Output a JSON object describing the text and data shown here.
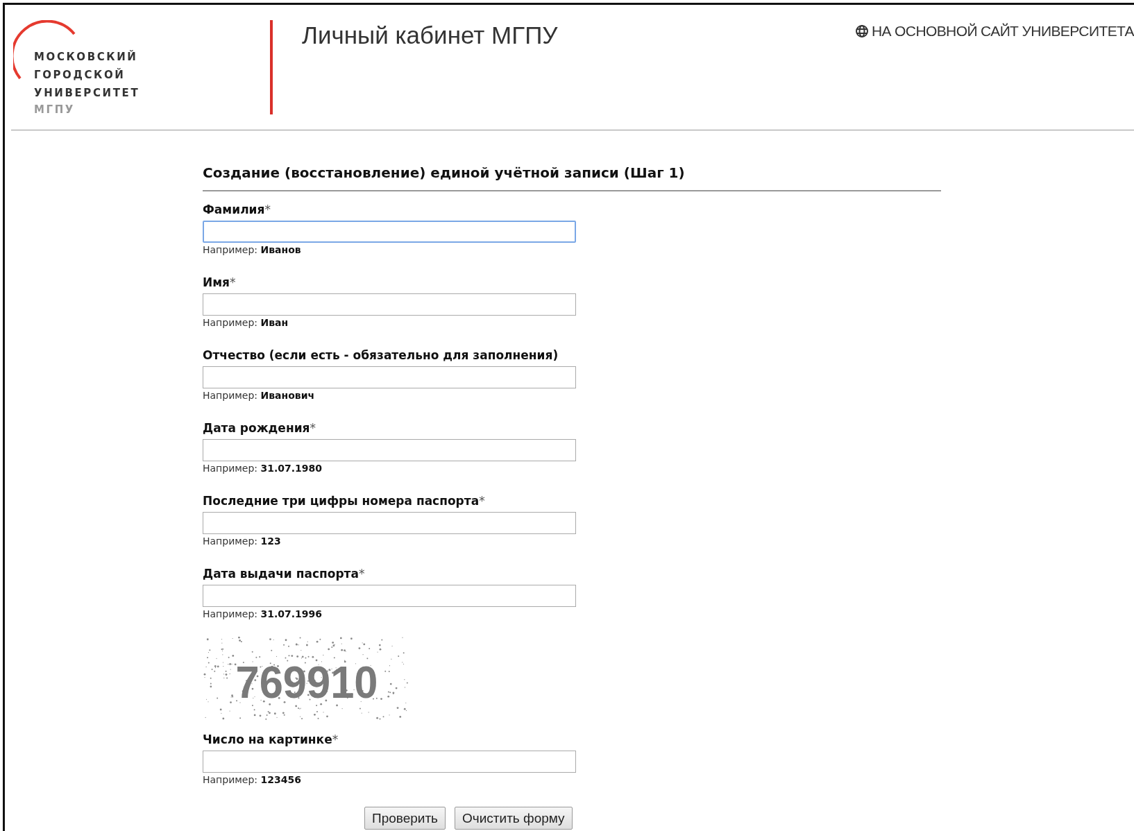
{
  "header": {
    "logo_lines": [
      "МОСКОВСКИЙ",
      "ГОРОДСКОЙ",
      "УНИВЕРСИТЕТ"
    ],
    "logo_abbr": "МГПУ",
    "title": "Личный кабинет МГПУ",
    "main_site_link": "НА ОСНОВНОЙ САЙТ УНИВЕРСИТЕТА"
  },
  "form": {
    "heading": "Создание (восстановление) единой учётной записи (Шаг 1)",
    "fields": [
      {
        "label": "Фамилия",
        "required_mark": "*",
        "focused": true,
        "hint": "Например: **Иванов**"
      },
      {
        "label": "Имя",
        "required_mark": "*",
        "focused": false,
        "hint": "Например: **Иван**"
      },
      {
        "label": "Отчество (если есть - обязательно для заполнения)",
        "focused": false,
        "hint": "Например: **Иванович**"
      },
      {
        "label": "Дата рождения",
        "required_mark": "*",
        "focused": false,
        "hint": "Например: **31.07.1980**"
      },
      {
        "label": "Последние три цифры номера паспорта",
        "required_mark": "*",
        "focused": false,
        "hint": "Например: **123**"
      },
      {
        "label": "Дата выдачи паспорта",
        "required_mark": "*",
        "focused": false,
        "hint": "Например: **31.07.1996**"
      }
    ],
    "captcha": {
      "code": "769910"
    },
    "captcha_field": {
      "label": "Число на картинке",
      "required_mark": "*",
      "focused": false,
      "hint": "Например: **123456**"
    },
    "buttons": [
      "Проверить",
      "Очистить форму"
    ]
  }
}
